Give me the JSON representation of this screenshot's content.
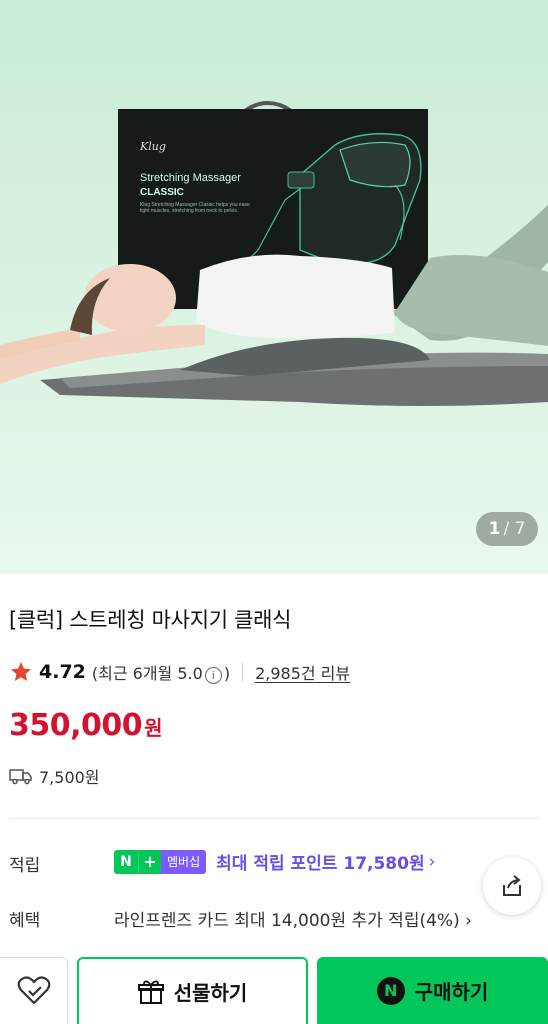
{
  "hero": {
    "box_brand": "Klug",
    "box_title": "Stretching Massager",
    "box_subtitle": "CLASSIC",
    "box_desc_line1": "Klug Stretching Massager Classic helps you ease",
    "box_desc_line2": "tight muscles, stretching from neck to pelvis.",
    "counter_current": "1",
    "counter_total": "/ 7"
  },
  "product": {
    "title": "[클럭] 스트레칭 마사지기 클래식",
    "rating": "4.72",
    "recent_prefix": "(최근 6개월 5.0",
    "recent_info_glyph": "i",
    "recent_suffix": ")",
    "reviews": "2,985건 리뷰",
    "price": "350,000",
    "price_unit": "원",
    "shipping": "7,500원"
  },
  "rows": {
    "points_label": "적립",
    "membership_n": "N",
    "membership_plus": "+",
    "membership_name": "멤버십",
    "points_text": "최대 적립 포인트 17,580원",
    "points_chevron": "›",
    "benefit_label": "혜택",
    "benefit_text": "라인프렌즈 카드 최대 14,000원 추가 적립(4%) ›"
  },
  "actions": {
    "gift_label": "선물하기",
    "buy_label": "구매하기",
    "buy_badge": "N"
  },
  "colors": {
    "price_red": "#d4122e",
    "naver_green": "#03c75a",
    "membership_purple": "#7d5bff",
    "hero_bg": "#dff6e6"
  },
  "icons": [
    "star-icon",
    "truck-icon",
    "share-icon",
    "heart-icon",
    "gift-icon",
    "naver-n-icon",
    "info-circle-icon"
  ]
}
